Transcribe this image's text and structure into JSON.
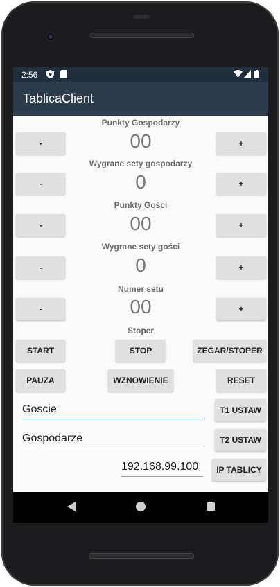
{
  "status": {
    "time": "2:56"
  },
  "app": {
    "title": "TablicaClient"
  },
  "home_points": {
    "label": "Punkty Gospodarzy",
    "value": "00",
    "minus": "-",
    "plus": "+"
  },
  "home_sets": {
    "label": "Wygrane sety gospodarzy",
    "value": "0",
    "minus": "-",
    "plus": "+"
  },
  "guest_points": {
    "label": "Punkty Gości",
    "value": "00",
    "minus": "-",
    "plus": "+"
  },
  "guest_sets": {
    "label": "Wygrane sety gości",
    "value": "0",
    "minus": "-",
    "plus": "+"
  },
  "set_number": {
    "label": "Numer setu",
    "value": "00",
    "minus": "-",
    "plus": "+"
  },
  "timer": {
    "label": "Stoper",
    "start": "START",
    "stop": "STOP",
    "clock_toggle": "ZEGAR/STOPER",
    "pause": "PAUZA",
    "resume": "WZNOWIENIE",
    "reset": "RESET"
  },
  "teams": {
    "team1_value": "Goscie",
    "team1_button": "T1 USTAW",
    "team2_value": "Gospodarze",
    "team2_button": "T2 USTAW"
  },
  "ip": {
    "value": "192.168.99.100",
    "button": "IP TABLICY"
  }
}
